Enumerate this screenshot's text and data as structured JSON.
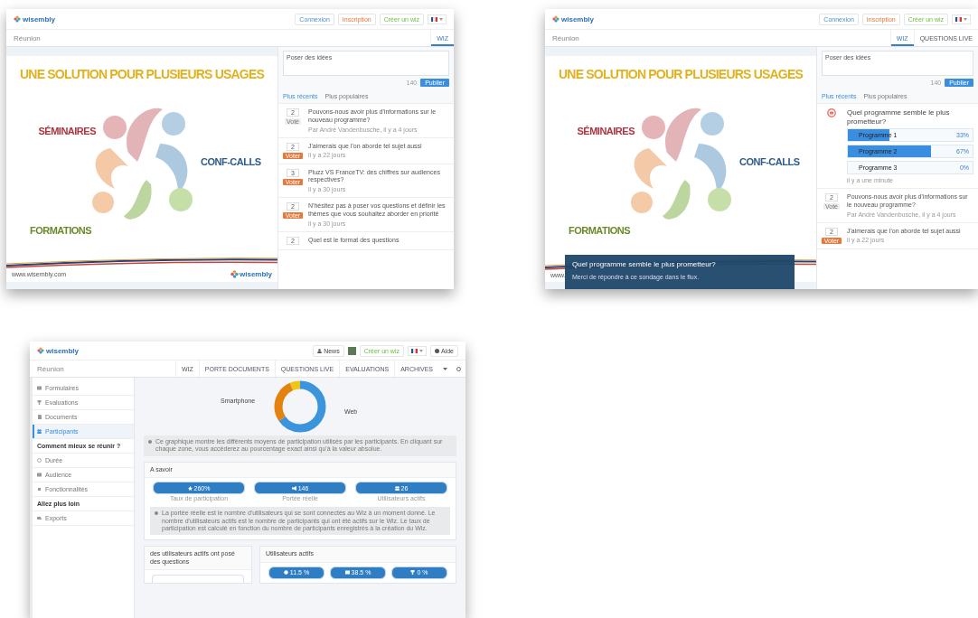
{
  "screenshots": [
    {
      "kind": "live",
      "brand": "wisembly",
      "header_buttons": [
        {
          "label": "Connexion",
          "kind": "login"
        },
        {
          "label": "Inscription",
          "kind": "signup"
        },
        {
          "label": "Créer un wiz",
          "kind": "create"
        },
        {
          "kind": "flag"
        }
      ],
      "title": "Réunion",
      "tabs": [
        {
          "label": "WIZ",
          "selected": true
        }
      ],
      "slide": {
        "heading": "UNE SOLUTION POUR PLUSIEURS USAGES",
        "labels": [
          {
            "text": "SÉMINAIRES",
            "color": "#b0333f"
          },
          {
            "text": "CONF-CALLS",
            "color": "#2d5a8c"
          },
          {
            "text": "FORMATIONS",
            "color": "#6a8a2a"
          }
        ],
        "url": "www.wisembly.com",
        "brand": "wisembly"
      },
      "compose": {
        "value": "Poser des idées",
        "counter": "140",
        "button": "Publier"
      },
      "sort_tabs": [
        {
          "label": "Plus récents",
          "selected": true
        },
        {
          "label": "Plus populaires",
          "selected": false
        }
      ],
      "questions": [
        {
          "votes": "2",
          "badge": "Voté",
          "voted": true,
          "text": "Pouvons-nous avoir plus d'informations sur le nouveau programme?",
          "meta": "Par André Vandenbusche, il y a 4 jours"
        },
        {
          "votes": "2",
          "badge": "Voter",
          "voted": false,
          "text": "J'aimerais que l'on aborde tel sujet aussi",
          "meta": "il y a 22 jours"
        },
        {
          "votes": "3",
          "badge": "Voter",
          "voted": false,
          "text": "Pluzz VS FranceTV: des chiffres sur audiences respectives?",
          "meta": "il y a 30 jours"
        },
        {
          "votes": "2",
          "badge": "Voter",
          "voted": false,
          "text": "N'hésitez pas à poser vos questions et définir les thèmes que vous souhaitez aborder en priorité",
          "meta": "il y a 30 jours"
        },
        {
          "votes": "2",
          "text": "Quel est le format des questions"
        }
      ]
    },
    {
      "kind": "live",
      "brand": "wisembly",
      "header_buttons": [
        {
          "label": "Connexion",
          "kind": "login"
        },
        {
          "label": "Inscription",
          "kind": "signup"
        },
        {
          "label": "Créer un wiz",
          "kind": "create"
        },
        {
          "kind": "flag"
        }
      ],
      "title": "Réunion",
      "tabs": [
        {
          "label": "WIZ",
          "selected": true
        },
        {
          "label": "QUESTIONS LIVE",
          "selected": false
        }
      ],
      "slide": {
        "heading": "UNE SOLUTION POUR PLUSIEURS USAGES",
        "labels": [
          {
            "text": "SÉMINAIRES",
            "color": "#b0333f"
          },
          {
            "text": "CONF-CALLS",
            "color": "#2d5a8c"
          },
          {
            "text": "FORMATIONS",
            "color": "#6a8a2a"
          }
        ],
        "url": "www."
      },
      "overlay": {
        "title": "Quel programme semble le plus prometteur?",
        "text": "Merci de répondre à ce sondage dans le flux."
      },
      "compose": {
        "value": "Poser des idées",
        "counter": "140",
        "button": "Publier"
      },
      "sort_tabs": [
        {
          "label": "Plus récents",
          "selected": true
        },
        {
          "label": "Plus populaires",
          "selected": false
        }
      ],
      "poll": {
        "question": "Quel programme semble le plus prometteur?",
        "options": [
          {
            "label": "Programme 1",
            "percent": "33%",
            "level": 0.33
          },
          {
            "label": "Programme 2",
            "percent": "67%",
            "level": 0.67
          },
          {
            "label": "Programme 3",
            "percent": "0%",
            "level": 0
          }
        ],
        "meta": "il y a une minute"
      },
      "questions": [
        {
          "votes": "2",
          "badge": "Voté",
          "voted": true,
          "text": "Pouvons-nous avoir plus d'informations sur le nouveau programme?",
          "meta": "Par André Vandenbusche, il y a 4 jours"
        },
        {
          "votes": "2",
          "badge": "Voter",
          "voted": false,
          "text": "J'aimerais que l'on aborde tel sujet aussi",
          "meta": "il y a 22 jours"
        }
      ]
    },
    {
      "kind": "stats",
      "brand": "wisembly",
      "header_buttons": [
        {
          "label": "News",
          "kind": "news"
        },
        {
          "kind": "avatar"
        },
        {
          "label": "Créer un wiz",
          "kind": "create"
        },
        {
          "kind": "flag"
        },
        {
          "label": "Aide",
          "kind": "help"
        }
      ],
      "title": "Réunion",
      "tabs": [
        {
          "label": "WIZ",
          "selected": false
        },
        {
          "label": "PORTE DOCUMENTS",
          "selected": false
        },
        {
          "label": "QUESTIONS LIVE",
          "selected": false
        },
        {
          "label": "EVALUATIONS",
          "selected": false
        },
        {
          "label": "ARCHIVES",
          "selected": false
        }
      ],
      "sidebar": {
        "items": [
          {
            "kind": "item",
            "label": "Formulaires",
            "selected": false
          },
          {
            "kind": "item",
            "label": "Evaluations",
            "selected": false
          },
          {
            "kind": "item",
            "label": "Documents",
            "selected": false
          },
          {
            "kind": "item",
            "label": "Participants",
            "selected": true
          },
          {
            "kind": "section",
            "label": "Comment mieux se réunir ?"
          },
          {
            "kind": "item",
            "label": "Durée",
            "selected": false
          },
          {
            "kind": "item",
            "label": "Audience",
            "selected": false
          },
          {
            "kind": "item",
            "label": "Fonctionnalités",
            "selected": false
          },
          {
            "kind": "section",
            "label": "Allez plus loin"
          },
          {
            "kind": "item",
            "label": "Exports",
            "selected": false
          }
        ]
      },
      "donut": {
        "labels": [
          "Smartphone",
          "Web"
        ]
      },
      "chart_note": "Ce graphique montre les différents moyens de participation utilisés par les participants. En cliquant sur chaque zone, vous accéderez au pourcentage exact ainsi qu'à la valeur absolue.",
      "summary": {
        "title": "A savoir",
        "stats": [
          {
            "value": "260%",
            "caption": "Taux de participation"
          },
          {
            "value": "146",
            "caption": "Portée réelle"
          },
          {
            "value": "26",
            "caption": "Utilisateurs actifs"
          }
        ],
        "note": "La portée réelle est le nombre d'utilisateurs qui se sont connectés au Wiz à un moment donné. Le nombre d'utilisateurs actifs est le nombre de participants qui ont été actifs sur le Wiz. Le taux de participation est calculé en fonction du nombre de participants enregistrés à la création du Wiz."
      },
      "cards": [
        {
          "title": "des utilisateurs actifs ont posé des questions"
        },
        {
          "title": "Utilisateurs actifs",
          "pills": [
            "11.5 %",
            "38.5 %",
            "0 %"
          ]
        }
      ]
    }
  ]
}
